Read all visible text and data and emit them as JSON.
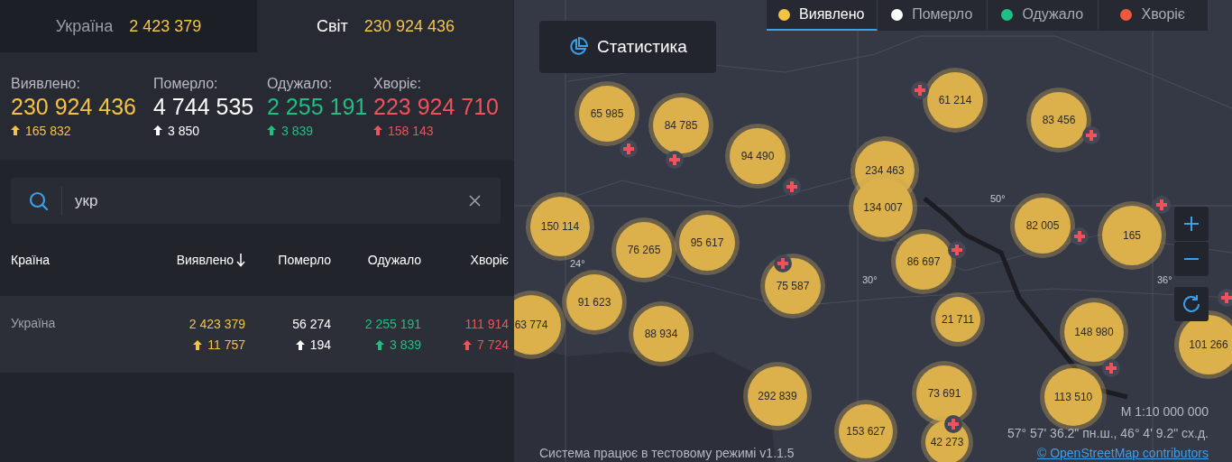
{
  "region_tabs": [
    {
      "label": "Україна",
      "value": "2 423 379",
      "selected": false
    },
    {
      "label": "Світ",
      "value": "230 924 436",
      "selected": true
    }
  ],
  "totals": [
    {
      "kind": "confirmed",
      "label": "Виявлено:",
      "value": "230 924 436",
      "delta": "165 832"
    },
    {
      "kind": "deaths",
      "label": "Померло:",
      "value": "4 744 535",
      "delta": "3 850"
    },
    {
      "kind": "recovered",
      "label": "Одужало:",
      "value": "2 255 191",
      "delta": "3 839"
    },
    {
      "kind": "sick",
      "label": "Хворіє:",
      "value": "223 924 710",
      "delta": "158 143"
    }
  ],
  "search": {
    "value": "укр"
  },
  "table": {
    "columns": [
      {
        "label": "Країна"
      },
      {
        "label": "Виявлено",
        "sorted": true
      },
      {
        "label": "Померло"
      },
      {
        "label": "Одужало"
      },
      {
        "label": "Хворіє"
      }
    ],
    "rows": [
      {
        "cells": [
          {
            "kind": "country",
            "value": "Україна"
          },
          {
            "kind": "confirmed",
            "value": "2 423 379",
            "delta": "11 757"
          },
          {
            "kind": "deaths",
            "value": "56 274",
            "delta": "194"
          },
          {
            "kind": "recovered",
            "value": "2 255 191",
            "delta": "3 839"
          },
          {
            "kind": "sick",
            "value": "111 914",
            "delta": "7 724"
          }
        ]
      }
    ]
  },
  "map": {
    "stats_button": "Статистика",
    "layers": [
      {
        "label": "Виявлено",
        "color": "#f5c344",
        "selected": true
      },
      {
        "label": "Померло",
        "color": "#ffffff",
        "selected": false
      },
      {
        "label": "Одужало",
        "color": "#1fbf82",
        "selected": false
      },
      {
        "label": "Хворіє",
        "color": "#f05a3c",
        "selected": false
      }
    ],
    "clusters": [
      "65 985",
      "84 785",
      "94 490",
      "234 463",
      "134 007",
      "61 214",
      "83 456",
      "150 114",
      "76 265",
      "95 617",
      "82 005",
      "165",
      "86 697",
      "75 587",
      "91 623",
      "63 774",
      "88 934",
      "21 711",
      "148 980",
      "101 266",
      "292 839",
      "73 691",
      "113 510",
      "153 627",
      "42 273"
    ],
    "grid_labels": [
      "24°",
      "30°",
      "36°",
      "50°"
    ],
    "scale": "М 1:10 000 000",
    "coordinates": "57° 57' 36.2\" пн.ш., 46° 4' 9.2\" сх.д.",
    "attribution": "© OpenStreetMap contributors",
    "footer": "Система працює в тестовому режимі v1.1.5"
  }
}
